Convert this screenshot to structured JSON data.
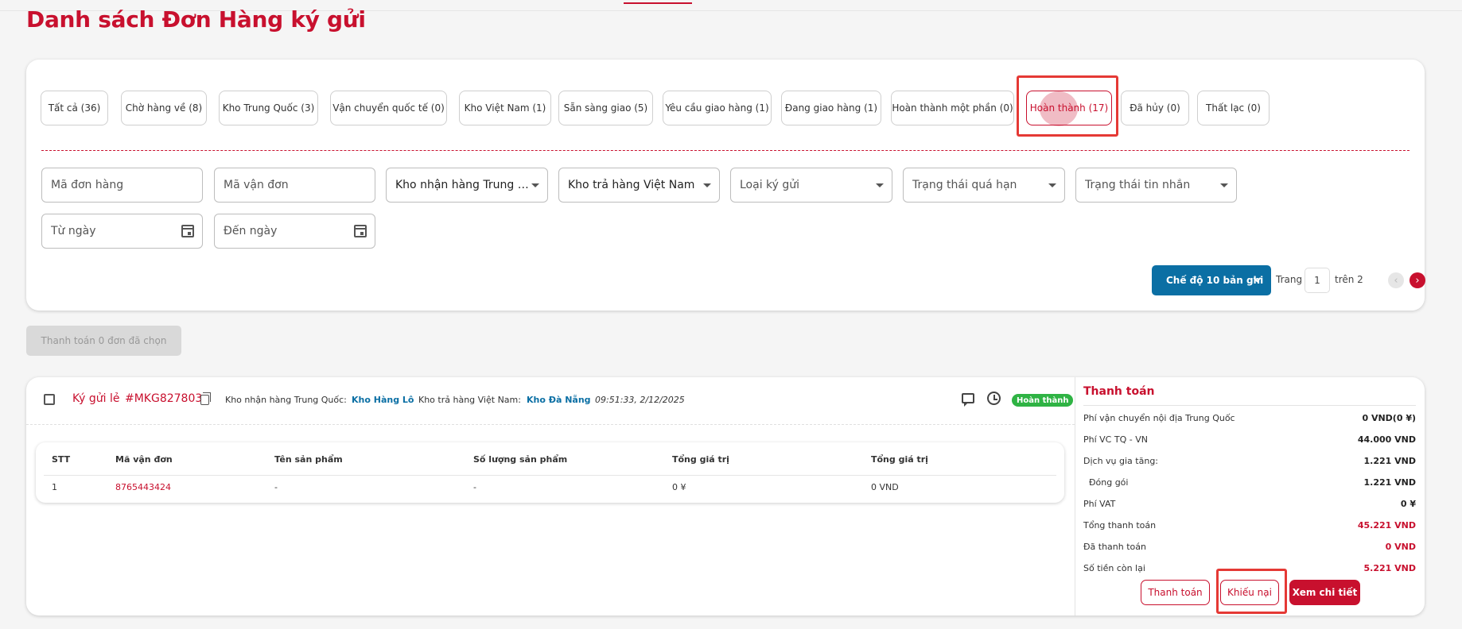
{
  "page_title": "Danh sách Đơn Hàng ký gửi",
  "tabs": [
    {
      "label": "Tất cả (36)"
    },
    {
      "label": "Chờ hàng về (8)"
    },
    {
      "label": "Kho Trung Quốc (3)"
    },
    {
      "label": "Vận chuyển quốc tế (0)"
    },
    {
      "label": "Kho Việt Nam (1)"
    },
    {
      "label": "Sẵn sàng giao (5)"
    },
    {
      "label": "Yêu cầu giao hàng (1)"
    },
    {
      "label": "Đang giao hàng (1)"
    },
    {
      "label": "Hoàn thành một phần (0)"
    },
    {
      "label": "Hoàn thành (17)",
      "active": true
    },
    {
      "label": "Đã hủy (0)"
    },
    {
      "label": "Thất lạc (0)"
    }
  ],
  "filters": {
    "order_code": "Mã đơn hàng",
    "tracking_code": "Mã vận đơn",
    "cn_warehouse": "Kho nhận hàng Trung Qu...",
    "vn_warehouse": "Kho trả hàng Việt Nam",
    "deposit_type": "Loại ký gửi",
    "overdue_status": "Trạng thái quá hạn",
    "message_status": "Trạng thái tin nhắn",
    "from_date": "Từ ngày",
    "to_date": "Đến ngày"
  },
  "pagination": {
    "mode_label": "Chế độ 10 bản ghi",
    "page_label": "Trang",
    "current_page": "1",
    "of_label": "trên 2",
    "prev": "‹",
    "next": "›"
  },
  "pay_selected_label": "Thanh toán 0 đơn đã chọn",
  "order": {
    "type": "Ký gửi lẻ",
    "code": "#MKG827803",
    "cn_warehouse_label": "Kho nhận hàng Trung Quốc:",
    "cn_warehouse_value": "Kho Hàng Lô",
    "vn_warehouse_label": "Kho trả hàng Việt Nam:",
    "vn_warehouse_value": "Kho Đà Nẵng",
    "time": "09:51:33, 2/12/2025",
    "status": "Hoàn thành",
    "table": {
      "headers": [
        "STT",
        "Mã vận đơn",
        "Tên sản phẩm",
        "Số lượng sản phẩm",
        "Tổng giá trị",
        "Tổng giá trị"
      ],
      "rows": [
        [
          "1",
          "8765443424",
          "-",
          "-",
          "0 ¥",
          "0 VND"
        ]
      ]
    },
    "payment": {
      "title": "Thanh toán",
      "rows": [
        {
          "label": "Phí vận chuyển nội địa Trung Quốc",
          "value": "0 VND(0 ¥)"
        },
        {
          "label": "Phí VC TQ - VN",
          "value": "44.000 VND"
        },
        {
          "label": "Dịch vụ gia tăng:",
          "value": "1.221 VND"
        },
        {
          "label": "Đóng gói",
          "value": "1.221 VND"
        },
        {
          "label": "Phí VAT",
          "value": "0 ¥"
        },
        {
          "label": "Tổng thanh toán",
          "value": "45.221 VND"
        },
        {
          "label": "Đã thanh toán",
          "value": "0 VND"
        },
        {
          "label": "Số tiền còn lại",
          "value": "5.221 VND"
        }
      ]
    },
    "actions": {
      "pay": "Thanh toán",
      "complain": "Khiếu nại",
      "detail": "Xem chi tiết"
    }
  },
  "colors": {
    "brand_red": "#c8102e",
    "accent_blue": "#0b6fa4",
    "status_green": "#2fb344",
    "highlight": "#e53935"
  }
}
